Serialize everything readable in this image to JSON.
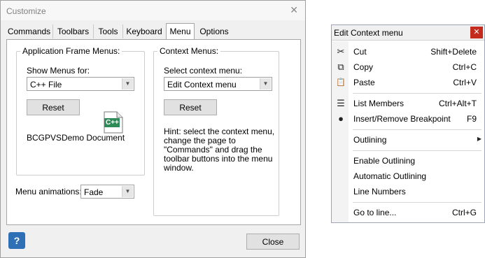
{
  "dialog": {
    "title": "Customize",
    "close_glyph": "✕",
    "tabs": [
      {
        "label": "Commands"
      },
      {
        "label": "Toolbars"
      },
      {
        "label": "Tools"
      },
      {
        "label": "Keyboard"
      },
      {
        "label": "Menu",
        "active": true
      },
      {
        "label": "Options"
      }
    ],
    "app_menus": {
      "group_label": "Application Frame Menus:",
      "show_label": "Show Menus for:",
      "show_value": "C++ File",
      "reset_label": "Reset",
      "icon_text": "C++",
      "doc_label": "BCGPVSDemo Document"
    },
    "context_menus": {
      "group_label": "Context Menus:",
      "select_label": "Select context menu:",
      "select_value": "Edit Context menu",
      "reset_label": "Reset",
      "hint": "Hint: select the context menu, change the page to \"Commands\" and drag the toolbar buttons into the menu window."
    },
    "animations": {
      "label": "Menu animations:",
      "value": "Fade"
    },
    "help_glyph": "?",
    "close_label": "Close"
  },
  "context_menu": {
    "title": "Edit Context menu",
    "close_glyph": "✕",
    "items": [
      {
        "label": "Cut",
        "shortcut": "Shift+Delete",
        "icon": "scissors-icon",
        "glyph": "✂"
      },
      {
        "label": "Copy",
        "shortcut": "Ctrl+C",
        "icon": "copy-icon",
        "glyph": "⧉"
      },
      {
        "label": "Paste",
        "shortcut": "Ctrl+V",
        "icon": "paste-icon",
        "glyph": "📋"
      },
      {
        "label": "List Members",
        "shortcut": "Ctrl+Alt+T",
        "icon": "list-members-icon",
        "glyph": "☰"
      },
      {
        "label": "Insert/Remove Breakpoint",
        "shortcut": "F9",
        "icon": "breakpoint-icon",
        "glyph": "●"
      },
      {
        "label": "Outlining",
        "shortcut": "",
        "submenu": "▶"
      },
      {
        "label": "Enable Outlining",
        "shortcut": ""
      },
      {
        "label": "Automatic Outlining",
        "shortcut": ""
      },
      {
        "label": "Line Numbers",
        "shortcut": ""
      },
      {
        "label": "Go to line...",
        "shortcut": "Ctrl+G"
      }
    ]
  }
}
